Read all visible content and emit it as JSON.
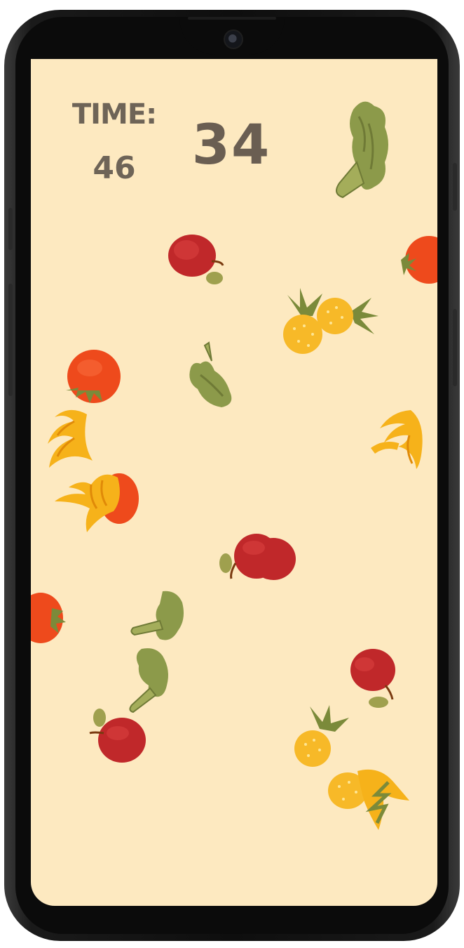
{
  "hud": {
    "time_label": "TIME:",
    "time_value": "46",
    "score": "34"
  },
  "items": [
    {
      "kind": "broccoli-icon"
    },
    {
      "kind": "apple-icon"
    },
    {
      "kind": "tomato-icon"
    },
    {
      "kind": "pineapple-icon"
    },
    {
      "kind": "pineapple-icon"
    },
    {
      "kind": "tomato-icon"
    },
    {
      "kind": "broccoli-icon"
    },
    {
      "kind": "banana-icon"
    },
    {
      "kind": "banana-icon"
    },
    {
      "kind": "banana-icon"
    },
    {
      "kind": "tomato-icon"
    },
    {
      "kind": "apple-icon"
    },
    {
      "kind": "tomato-icon"
    },
    {
      "kind": "broccoli-icon"
    },
    {
      "kind": "broccoli-icon"
    },
    {
      "kind": "apple-icon"
    },
    {
      "kind": "apple-icon"
    },
    {
      "kind": "pineapple-icon"
    },
    {
      "kind": "pineapple-icon"
    },
    {
      "kind": "banana-icon"
    }
  ],
  "colors": {
    "background": "#fde9c0",
    "hud_text": "#6e6457",
    "apple": "#c0282a",
    "tomato": "#ee4a1c",
    "banana": "#f6b21a",
    "pineapple": "#f7b928",
    "broccoli": "#8c9a4a"
  }
}
